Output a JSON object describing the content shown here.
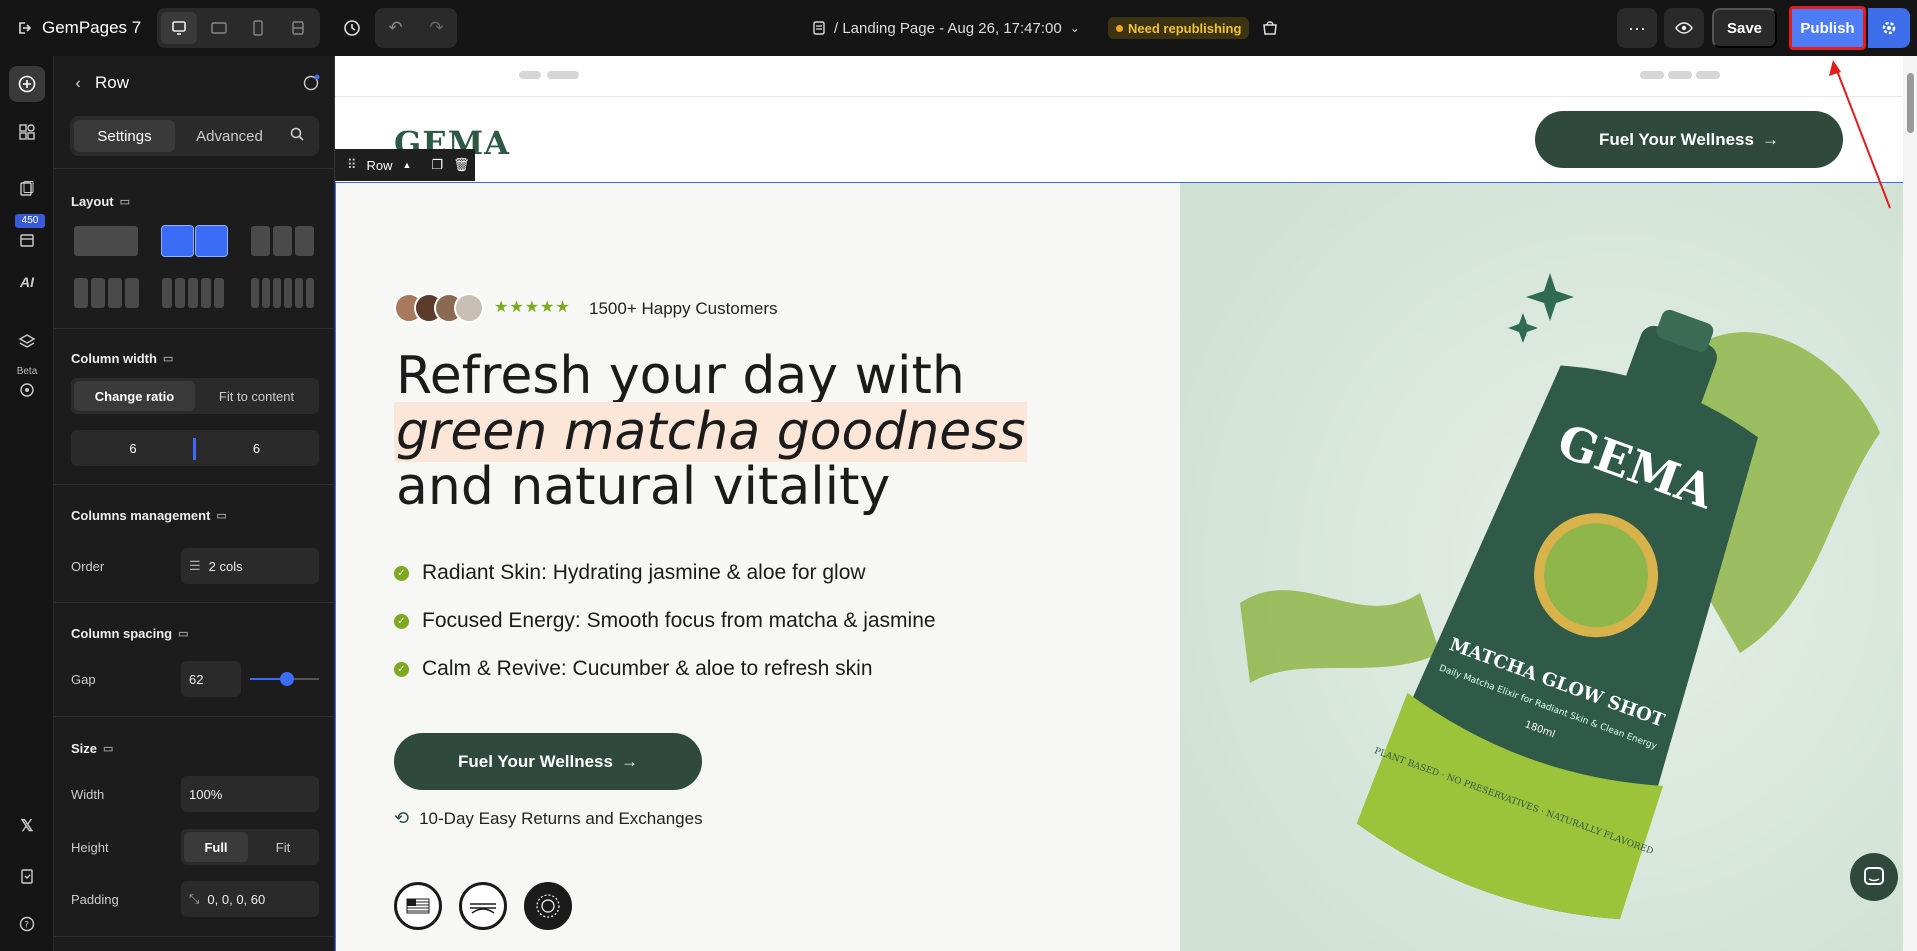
{
  "app": {
    "name": "GemPages 7"
  },
  "topbar": {
    "page_title": "/ Landing Page - Aug 26, 17:47:00",
    "status_badge": "Need republishing",
    "save_label": "Save",
    "publish_label": "Publish"
  },
  "sidebar": {
    "badge_count": "450",
    "beta_label": "Beta"
  },
  "panel": {
    "title": "Row",
    "tabs": {
      "settings": "Settings",
      "advanced": "Advanced"
    },
    "layout": {
      "title": "Layout"
    },
    "column_width": {
      "title": "Column width",
      "change_ratio": "Change ratio",
      "fit_to_content": "Fit to content",
      "left": "6",
      "right": "6"
    },
    "columns_management": {
      "title": "Columns management",
      "order_label": "Order",
      "order_value": "2 cols"
    },
    "column_spacing": {
      "title": "Column spacing",
      "gap_label": "Gap",
      "gap_value": "62"
    },
    "size": {
      "title": "Size",
      "width_label": "Width",
      "width_value": "100%",
      "height_label": "Height",
      "height_full": "Full",
      "height_fit": "Fit",
      "padding_label": "Padding",
      "padding_value": "0, 0, 0, 60"
    }
  },
  "canvas": {
    "row_tag": "Row",
    "logo": "GEMA",
    "header_cta": "Fuel Your Wellness",
    "stars": "★★★★★",
    "reviews": "1500+ Happy Customers",
    "headline_1": "Refresh your day with",
    "headline_2": "green matcha goodness",
    "headline_3": "and natural vitality",
    "bullets": [
      "Radiant Skin: Hydrating jasmine & aloe for glow",
      "Focused Energy: Smooth focus from matcha & jasmine",
      "Calm & Revive: Cucumber & aloe to refresh skin"
    ],
    "cta": "Fuel Your Wellness",
    "returns": "10-Day Easy Returns and Exchanges",
    "product": {
      "brand": "GEMA",
      "name": "MATCHA GLOW SHOT",
      "tagline": "Daily Matcha Elixir for Radiant Skin & Clean Energy",
      "volume": "180ml",
      "claims": "PLANT BASED · NO PRESERVATIVES · NATURALLY FLAVORED"
    }
  },
  "colors": {
    "accent": "#3b6cf6",
    "brand_green": "#2f4a3c",
    "star_green": "#7caa1e",
    "highlight": "#fbe6d8"
  }
}
